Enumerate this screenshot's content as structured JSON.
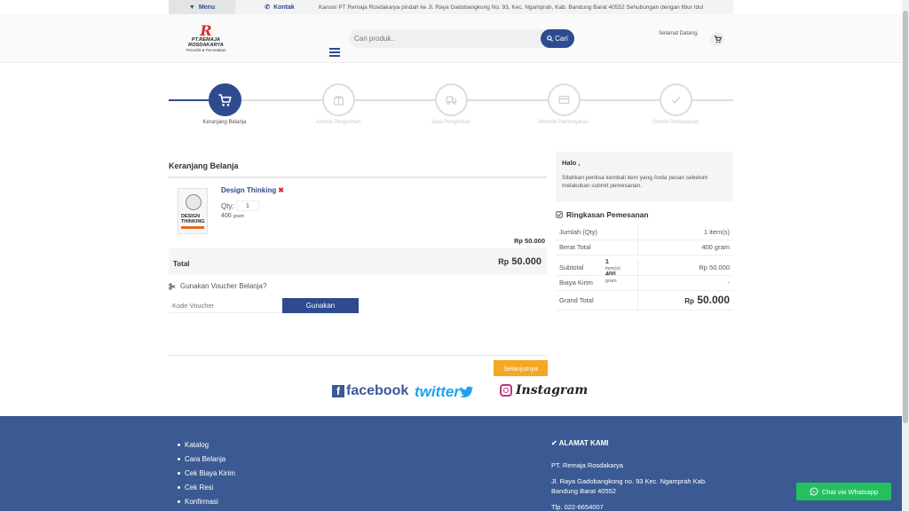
{
  "topbar": {
    "menu_label": "Menu",
    "kontak_label": "Kontak",
    "marquee": "Kansor PT Remaja Rosdakarya pindah ke Jl. Raya Gadobangkong No. 93, Kec. Ngamprah, Kab. Bandung Barat 40552     Sehubungan dengan libur Idul"
  },
  "header": {
    "logo_name": "PT.REMAJA ROSDAKARYA",
    "logo_sub": "Penerbit & Percetakan",
    "search_placeholder": "Cari produk..",
    "search_button": "Cari",
    "greeting": "Selamat Datang,"
  },
  "steps": [
    {
      "label": "Keranjang Belanja",
      "active": true
    },
    {
      "label": "Alamat Pengiriman",
      "active": false
    },
    {
      "label": "Jasa Pengiriman",
      "active": false
    },
    {
      "label": "Metode Pembayaran",
      "active": false
    },
    {
      "label": "Submit Pemesanan",
      "active": false
    }
  ],
  "cart": {
    "title": "Keranjang Belanja",
    "book_cover_text": "DESIGN THINKING",
    "item": {
      "name": "Design Thinking",
      "remove": "✖",
      "qty_label": "Qty:",
      "qty": "1",
      "weight": "400",
      "weight_unit": "gram",
      "price": "Rp 50.000"
    },
    "total": {
      "label": "Total",
      "count": "1",
      "count_unit": "item(s)",
      "weight": "400",
      "weight_unit": "gram",
      "currency": "Rp",
      "amount": "50.000"
    },
    "voucher_label": "Gunakan Voucher Belanja?",
    "voucher_placeholder": "Kode Voucher",
    "voucher_button": "Gunakan",
    "next_button": "Selanjutnya"
  },
  "social": {
    "facebook": "facebook",
    "twitter": "twitter",
    "instagram": "Instagram"
  },
  "panel": {
    "halo_title": "Halo ,",
    "halo_text": "Silahkan periksa kembali item yang Anda pesan sebelum melakukan submit pemesanan.",
    "summary_title": "Ringkasan Pemesanan",
    "rows": {
      "jumlah_label": "Jumlah (Qty)",
      "jumlah_value": "1 item(s)",
      "berat_label": "Berat Total",
      "berat_value": "400 gram",
      "subtotal_label": "Subtotal",
      "subtotal_value": "Rp 50.000",
      "biaya_label": "Biaya Kirim",
      "biaya_value": "-",
      "grand_label": "Grand Total",
      "grand_currency": "Rp",
      "grand_value": "50.000"
    }
  },
  "footer": {
    "links": [
      "Katalog",
      "Cara Belanja",
      "Cek Biaya Kirim",
      "Cek Resi",
      "Konfirmasi"
    ],
    "address_title": "ALAMAT KAMI",
    "company": "PT. Remaja Rosdakarya",
    "address": "Jl. Raya Gadobangkong no. 93 Kec. Ngamprah Kab. Bandung Barat 40552",
    "phone": "Tlp. 022-6654007"
  },
  "whatsapp_button": "Chat via Whatsapp",
  "colors": {
    "primary": "#2d4b8e",
    "accent": "#f5a623",
    "footer": "#3b5a93",
    "whatsapp": "#25c160"
  }
}
